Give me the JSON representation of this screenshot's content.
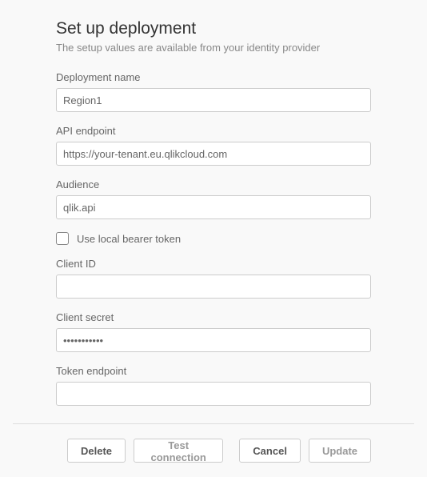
{
  "header": {
    "title": "Set up deployment",
    "subtitle": "The setup values are available from your identity provider"
  },
  "fields": {
    "deployment_name": {
      "label": "Deployment name",
      "value": "Region1"
    },
    "api_endpoint": {
      "label": "API endpoint",
      "value": "https://your-tenant.eu.qlikcloud.com"
    },
    "audience": {
      "label": "Audience",
      "value": "qlik.api"
    },
    "local_token": {
      "label": "Use local bearer token",
      "checked": false
    },
    "client_id": {
      "label": "Client ID",
      "value": ""
    },
    "client_secret": {
      "label": "Client secret",
      "value": "•••••••••••"
    },
    "token_endpoint": {
      "label": "Token endpoint",
      "value": ""
    }
  },
  "buttons": {
    "delete": "Delete",
    "test": "Test connection",
    "cancel": "Cancel",
    "update": "Update"
  }
}
